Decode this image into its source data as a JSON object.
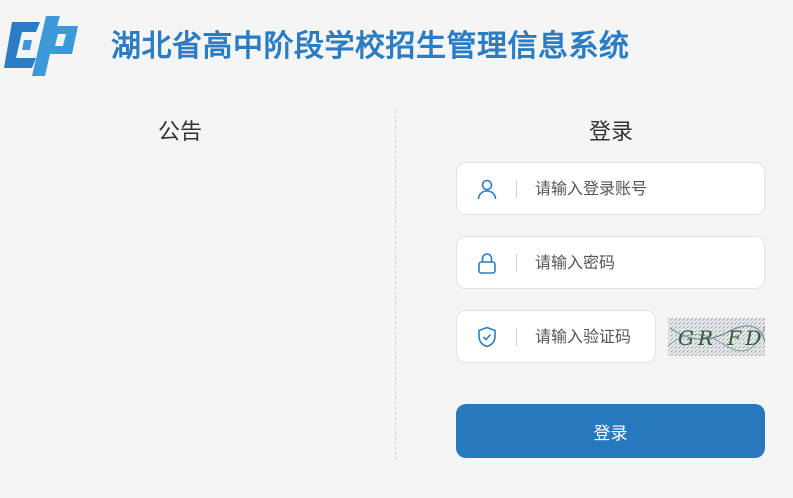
{
  "header": {
    "title": "湖北省高中阶段学校招生管理信息系统",
    "logo_icon": "cp-logo-icon"
  },
  "notice": {
    "title": "公告"
  },
  "login": {
    "title": "登录",
    "username": {
      "placeholder": "请输入登录账号",
      "value": "",
      "icon": "user-icon"
    },
    "password": {
      "placeholder": "请输入密码",
      "value": "",
      "icon": "lock-icon"
    },
    "captcha": {
      "placeholder": "请输入验证码",
      "value": "",
      "icon": "shield-check-icon",
      "image_text": "GR FD"
    },
    "submit_label": "登录"
  },
  "colors": {
    "brand": "#2a7dc4",
    "button": "#2878bd",
    "background": "#f5f5f5"
  }
}
